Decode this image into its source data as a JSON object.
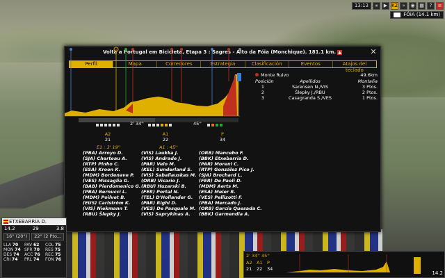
{
  "hud": {
    "timer": "13:13",
    "speed_toggle": "K2",
    "location": "FÓIA (14.1 km)"
  },
  "modal": {
    "title": "Volta a Portugal em Bicicleta, Etapa 3 : Sagres - Alto da Fóia (Monchique). 181.1 km.",
    "close": "✕",
    "tabs": [
      "Perfil",
      "Mapa",
      "Corredores",
      "Estrategia",
      "Clasificación",
      "Eventos",
      "Atajos del teclado"
    ],
    "active_tab": 0
  },
  "profile": {
    "gap_top_1": "2' 34''",
    "gap_top_2": "45''",
    "climbs": [
      {
        "cat": "A2",
        "num": "21"
      },
      {
        "cat": "A1",
        "num": "22"
      },
      {
        "cat": "P",
        "num": "34"
      }
    ],
    "groups": [
      "E1 : 3' 19''",
      "A1 : 45''"
    ]
  },
  "classification": {
    "point": "Monte Ruivo",
    "distance": "49.6km",
    "headers": [
      "Posición",
      "Apellidos",
      "Montaña"
    ],
    "rows": [
      {
        "pos": "1",
        "name": "Sarensen N./VIS",
        "pts": "3 Ptos."
      },
      {
        "pos": "2",
        "name": "Šlepky J./RBU",
        "pts": "2 Ptos."
      },
      {
        "pos": "3",
        "name": "Casagranda S./VES",
        "pts": "1 Ptos."
      }
    ]
  },
  "riders": {
    "col1": [
      "(PBA) Arroyo D.",
      "(SJA) Charteau A.",
      "(RTP) Pinho C.",
      "(ESA) Kroon K.",
      "(MDM) Bordenave P.",
      "(VES) Missaglia G.",
      "(BAB) Pierdomenico G.",
      "(PBA) Bernucci L.",
      "(MDM) Poilvet B.",
      "(EUS) Carlström K.",
      "(VIS) Niekmann T.",
      "(RBU) Šlepky J."
    ],
    "col2": [
      "(VIS) Laukka J.",
      "(VIS) Andrade J.",
      "(PAR) Velo M.",
      "(KEL) Sunderland S.",
      "(VIS) Sabaliauskas M.",
      "(ORB) Vicario J.",
      "(RBU) Huzarski B.",
      "(FER) Portal N.",
      "(TEL) D'Hollander G.",
      "(PAR) Righi D.",
      "(VES) De Pasquale M.",
      "(VIS) Saprykinas A."
    ],
    "col3": [
      "(ORB) Mancebo F.",
      "(BBK) Etxebarria D.",
      "(PAR) Moreni C.",
      "(RTP) González Pico J.",
      "(SJA) Brochard L.",
      "(FER) De Paoli D.",
      "(MDM) Aerts M.",
      "(ESA) Meier R.",
      "(VES) Pellizotti F.",
      "(PBA) Mercado J.",
      "(ORB) García Quesada C.",
      "(BBK) Garmendia A."
    ]
  },
  "rider_hud": {
    "name": "ETXEBARRIA D.",
    "number": "29",
    "speed": "14.2",
    "stat_a": "3.8",
    "temps": [
      "16° (20°)",
      "22° (2 Pto..."
    ],
    "stats": [
      {
        "k": "LLA",
        "v": "70"
      },
      {
        "k": "PAV",
        "v": "62"
      },
      {
        "k": "COL",
        "v": "75"
      },
      {
        "k": "MON",
        "v": "74"
      },
      {
        "k": "SPR",
        "v": "70"
      },
      {
        "k": "RES",
        "v": "75"
      },
      {
        "k": "DES",
        "v": "74"
      },
      {
        "k": "ACC",
        "v": "76"
      },
      {
        "k": "REC",
        "v": "75"
      },
      {
        "k": "CRI",
        "v": "74"
      },
      {
        "k": "PRL",
        "v": "74"
      },
      {
        "k": "FON",
        "v": "76"
      }
    ]
  },
  "minimap": {
    "labels": [
      "2' 34''",
      "45''",
      "A2",
      "A1",
      "P",
      "21",
      "22",
      "34"
    ],
    "speed": "14.2"
  }
}
